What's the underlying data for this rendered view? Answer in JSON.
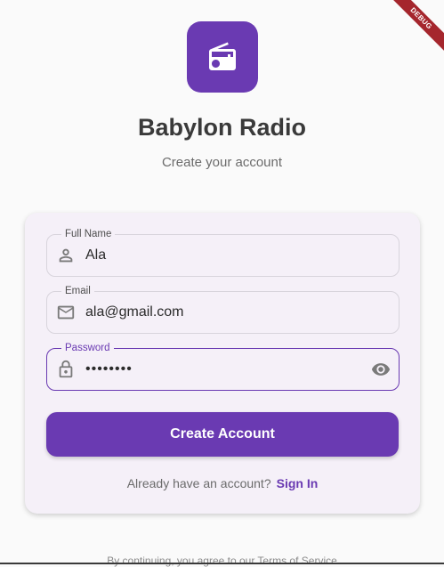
{
  "debug_banner": "DEBUG",
  "app": {
    "icon": "radio-icon",
    "title": "Babylon Radio",
    "subtitle": "Create your account"
  },
  "form": {
    "full_name": {
      "label": "Full Name",
      "value": "Ala",
      "icon": "person-icon"
    },
    "email": {
      "label": "Email",
      "value": "ala@gmail.com",
      "icon": "mail-icon"
    },
    "password": {
      "label": "Password",
      "value": "••••••••",
      "icon": "lock-icon",
      "toggle_icon": "eye-icon"
    },
    "submit_label": "Create Account"
  },
  "signin": {
    "prompt": "Already have an account?",
    "link_label": "Sign In"
  },
  "terms_text": "By continuing, you agree to our Terms of Service",
  "colors": {
    "primary": "#6a3ab2",
    "card_bg": "#f5f0f8",
    "page_bg": "#fafafa",
    "debug_banner": "#a5262d"
  }
}
